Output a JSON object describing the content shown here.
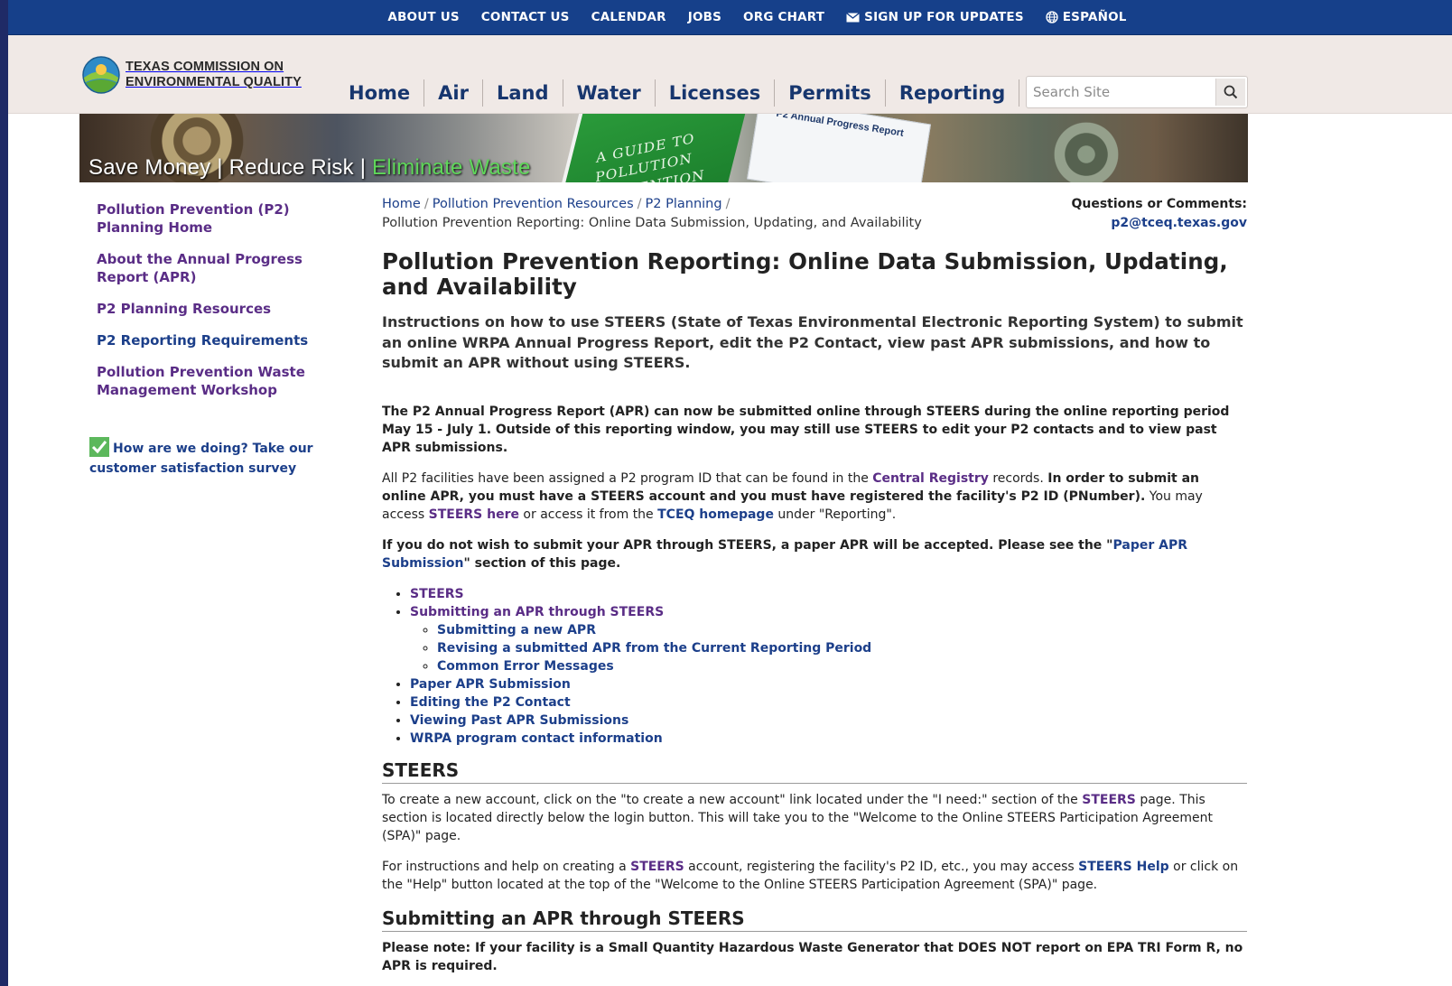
{
  "topbar": {
    "items": [
      "ABOUT US",
      "CONTACT US",
      "CALENDAR",
      "JOBS",
      "ORG CHART",
      "SIGN UP FOR UPDATES",
      "ESPAÑOL"
    ]
  },
  "header": {
    "logo_line1": "TEXAS COMMISSION ON",
    "logo_line2": "ENVIRONMENTAL QUALITY",
    "nav": [
      "Home",
      "Air",
      "Land",
      "Water",
      "Licenses",
      "Permits",
      "Reporting"
    ],
    "search_placeholder": "Search Site"
  },
  "banner": {
    "tagline_part1": "Save Money | Reduce Risk | ",
    "tagline_part2": "Eliminate Waste",
    "book_text": "A GUIDE TO POLLUTION PREVENTION",
    "report_text": "P2 Annual Progress Report"
  },
  "sidebar": {
    "items": [
      "Pollution Prevention (P2) Planning Home",
      "About the Annual Progress Report (APR)",
      "P2 Planning Resources",
      "P2 Reporting Requirements",
      "Pollution Prevention Waste Management Workshop"
    ],
    "survey": "How are we doing? Take our customer satisfaction survey"
  },
  "breadcrumb": {
    "items": [
      "Home",
      "Pollution Prevention Resources",
      "P2 Planning"
    ],
    "current": "Pollution Prevention Reporting: Online Data Submission, Updating, and Availability"
  },
  "questions": {
    "label": "Questions or Comments:",
    "email": "p2@tceq.texas.gov"
  },
  "page": {
    "title": "Pollution Prevention Reporting: Online Data Submission, Updating, and Availability",
    "lead": "Instructions on how to use STEERS (State of Texas Environmental Electronic Reporting System) to submit an online WRPA Annual Progress Report, edit the P2 Contact, view past APR submissions, and how to submit an APR without using STEERS.",
    "p1": "The P2 Annual Progress Report (APR) can now be submitted online through STEERS during the online reporting period May 15 - July 1. Outside of this reporting window, you may still use STEERS to edit your P2 contacts and to view past APR submissions.",
    "p2": {
      "a": "All P2 facilities have been assigned a P2 program ID that can be found in the ",
      "link1": "Central Registry",
      "b": " records. ",
      "bold": "In order to submit an online APR, you must have a STEERS account and you must have registered the facility's P2 ID (PNumber).",
      "c": " You may access ",
      "link2": "STEERS here",
      "d": " or access it from the ",
      "link3": "TCEQ homepage",
      "e": " under \"Reporting\"."
    },
    "p3": {
      "a": "If you do not wish to submit your APR through STEERS, a paper APR will be accepted. Please see the \"",
      "link": "Paper APR Submission",
      "b": "\" section of this page."
    },
    "toc": {
      "steers": "STEERS",
      "submitting": "Submitting an APR through STEERS",
      "sub1": "Submitting a new APR",
      "sub2": "Revising a submitted APR from the Current Reporting Period",
      "sub3": "Common Error Messages",
      "paper": "Paper APR Submission",
      "editing": "Editing the P2 Contact",
      "viewing": "Viewing Past APR Submissions",
      "wrpa": "WRPA program contact information"
    },
    "h2_steers": "STEERS",
    "steers_p1": {
      "a": "To create a new account, click on the \"to create a new account\" link located under the \"I need:\" section of the ",
      "link": "STEERS",
      "b": " page. This section is located directly below the login button. This will take you to the \"Welcome to the Online STEERS Participation Agreement (SPA)\" page."
    },
    "steers_p2": {
      "a": "For instructions and help on creating a ",
      "link1": "STEERS",
      "b": " account, registering the facility's P2 ID, etc., you may access ",
      "link2": "STEERS Help",
      "c": " or click on the \"Help\" button located at the top of the \"Welcome to the Online STEERS Participation Agreement (SPA)\" page."
    },
    "h2_submitting": "Submitting an APR through STEERS",
    "note": "Please note: If your facility is a Small Quantity Hazardous Waste Generator that DOES NOT report on EPA TRI Form R, no APR is required."
  },
  "colors": {
    "topbar": "#16408a",
    "header_bg": "#f0e9e6",
    "link_blue": "#1c3f8a",
    "link_purple": "#5a2d86",
    "outer_bg": "#1f2a66"
  }
}
